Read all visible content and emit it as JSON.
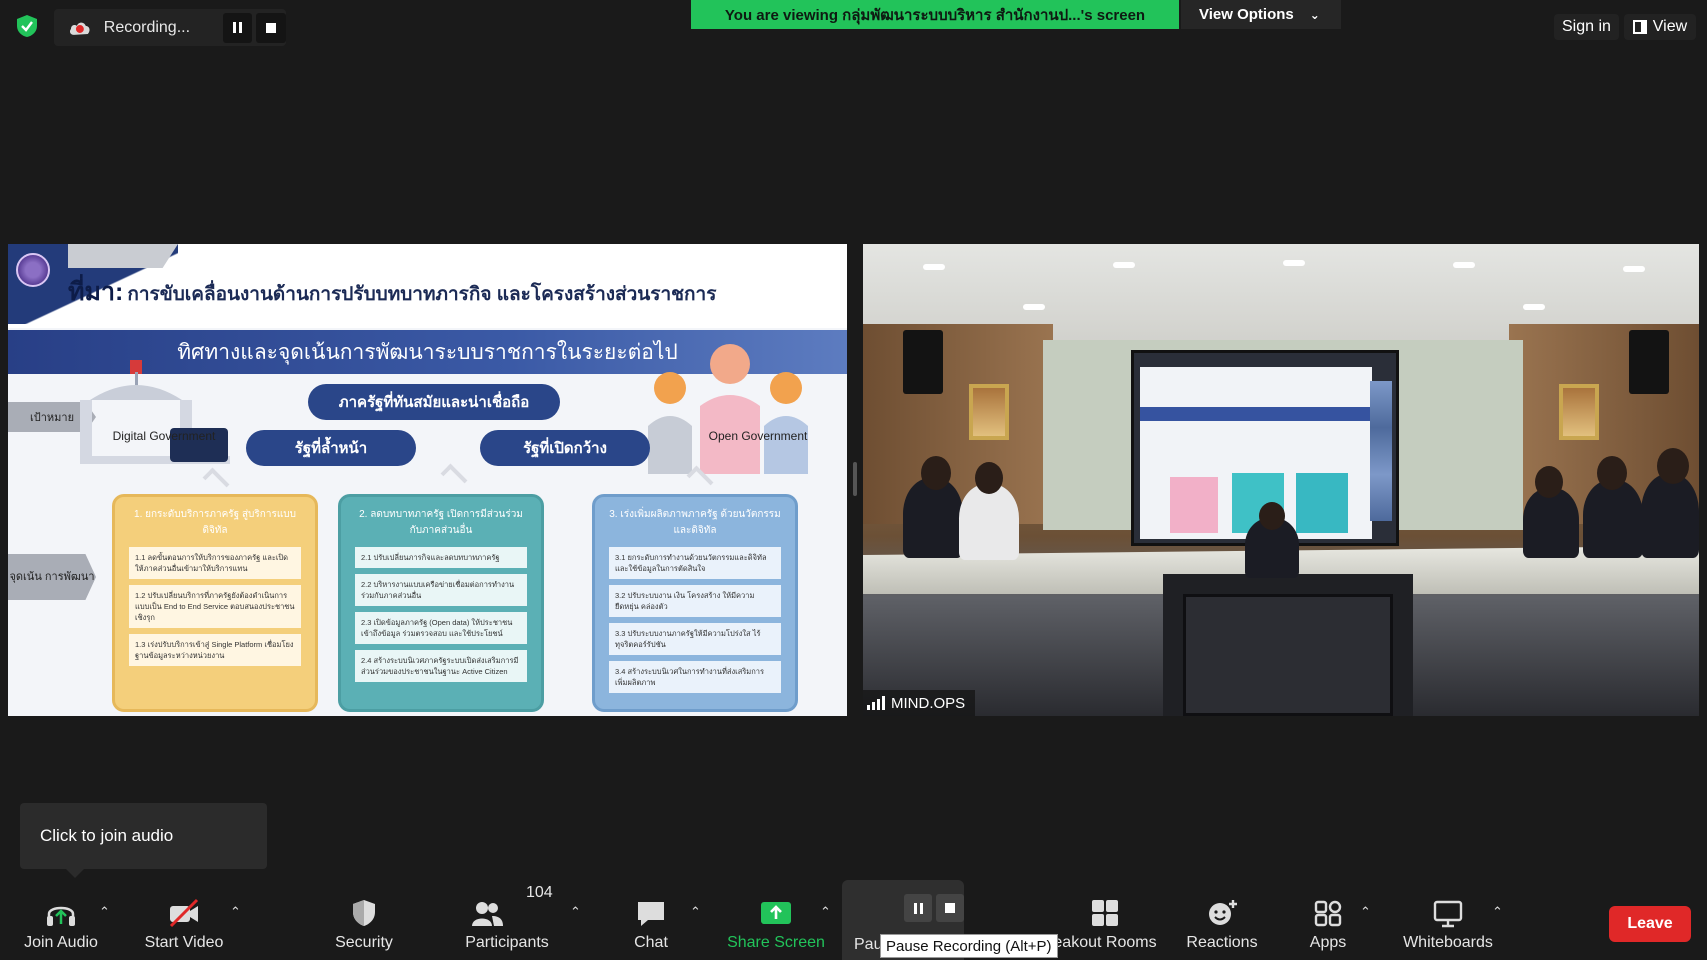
{
  "top": {
    "recording_label": "Recording...",
    "banner": "You are viewing กลุ่มพัฒนาระบบบริหาร สำนักงานป...'s screen",
    "view_options": "View Options",
    "sign_in": "Sign in",
    "view": "View"
  },
  "slide": {
    "title_lead": "ที่มา:",
    "title_rest": "การขับเคลื่อนงานด้านการปรับบทบาทภารกิจ และโครงสร้างส่วนราชการ",
    "band": "ทิศทางและจุดเน้นการพัฒนาระบบราชการในระยะต่อไป",
    "goal_tag": "เป้าหมาย",
    "focus_tag": "จุดเน้น การพัฒนา",
    "pill_main": "ภาครัฐที่ทันสมัยและน่าเชื่อถือ",
    "pill_left": "รัฐที่ล้ำหน้า",
    "pill_right": "รัฐที่เปิดกว้าง",
    "dg_label": "Digital Government",
    "og_label": "Open Government",
    "columns": [
      {
        "head": "1. ยกระดับบริการภาครัฐ สู่บริการแบบดิจิทัล",
        "items": [
          "1.1 ลดขั้นตอนการให้บริการของภาครัฐ และเปิดให้ภาคส่วนอื่นเข้ามาให้บริการแทน",
          "1.2 ปรับเปลี่ยนบริการที่ภาครัฐยังต้องดำเนินการแบบเป็น End to End Service ตอบสนองประชาชนเชิงรุก",
          "1.3 เร่งปรับบริการเข้าสู่ Single Platform เชื่อมโยงฐานข้อมูลระหว่างหน่วยงาน"
        ]
      },
      {
        "head": "2. ลดบทบาทภาครัฐ เปิดการมีส่วนร่วมกับภาคส่วนอื่น",
        "items": [
          "2.1 ปรับเปลี่ยนภารกิจและลดบทบาทภาครัฐ",
          "2.2 บริหารงานแบบเครือข่ายเชื่อมต่อการทำงานร่วมกับภาคส่วนอื่น",
          "2.3 เปิดข้อมูลภาครัฐ (Open data) ให้ประชาชนเข้าถึงข้อมูล ร่วมตรวจสอบ และใช้ประโยชน์",
          "2.4 สร้างระบบนิเวศภาครัฐระบบเปิดส่งเสริมการมีส่วนร่วมของประชาชนในฐานะ Active Citizen"
        ]
      },
      {
        "head": "3. เร่งเพิ่มผลิตภาพภาครัฐ ด้วยนวัตกรรมและดิจิทัล",
        "items": [
          "3.1 ยกระดับการทำงานด้วยนวัตกรรมและดิจิทัล และใช้ข้อมูลในการตัดสินใจ",
          "3.2 ปรับระบบงาน เงิน โครงสร้าง ให้มีความยืดหยุ่น คล่องตัว",
          "3.3 ปรับระบบงานภาครัฐให้มีความโปร่งใส ไร้ทุจริตคอร์รัปชัน",
          "3.4 สร้างระบบนิเวศในการทำงานที่ส่งเสริมการเพิ่มผลิตภาพ"
        ]
      }
    ]
  },
  "video": {
    "name": "MIND.OPS"
  },
  "tooltip": "Click to join audio",
  "toolbar": {
    "join_audio": "Join Audio",
    "start_video": "Start Video",
    "security": "Security",
    "participants": "Participants",
    "participant_count": "104",
    "chat": "Chat",
    "share_screen": "Share Screen",
    "pause_partial": "Pau",
    "pause_tip": "Pause Recording (Alt+P)",
    "breakout_partial": "eakout Rooms",
    "reactions": "Reactions",
    "apps": "Apps",
    "whiteboards": "Whiteboards",
    "leave": "Leave"
  },
  "colors": {
    "accent_green": "#22c35a",
    "leave_red": "#e02828",
    "slide_navy": "#2a4689"
  }
}
